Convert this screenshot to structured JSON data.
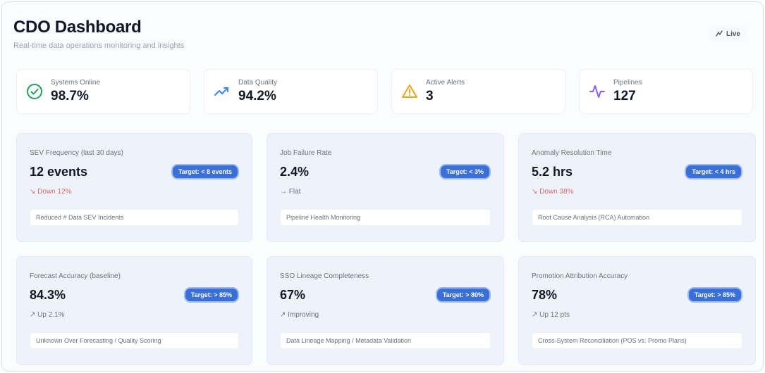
{
  "header": {
    "title": "CDO Dashboard",
    "subtitle": "Real-time data operations monitoring and insights",
    "live_label": "Live"
  },
  "kpis": [
    {
      "label": "Systems Online",
      "value": "98.7%",
      "icon": "check-circle-icon",
      "color": "#22a05a"
    },
    {
      "label": "Data Quality",
      "value": "94.2%",
      "icon": "trending-up-icon",
      "color": "#3b82f6"
    },
    {
      "label": "Active Alerts",
      "value": "3",
      "icon": "warning-triangle-icon",
      "color": "#e6a817"
    },
    {
      "label": "Pipelines",
      "value": "127",
      "icon": "activity-icon",
      "color": "#8b5cf6"
    }
  ],
  "cards": [
    {
      "label": "SEV Frequency (last 30 days)",
      "value": "12 events",
      "target": "Target: < 8 events",
      "trend": "↘ Down 12%",
      "trend_type": "down",
      "note": "Reduced # Data SEV Incidents"
    },
    {
      "label": "Job Failure Rate",
      "value": "2.4%",
      "target": "Target: < 3%",
      "trend": "→ Flat",
      "trend_type": "flat",
      "note": "Pipeline Health Monitoring"
    },
    {
      "label": "Anomaly Resolution Time",
      "value": "5.2 hrs",
      "target": "Target: < 4 hrs",
      "trend": "↘ Down 38%",
      "trend_type": "down",
      "note": "Root Cause Analysis (RCA) Automation"
    },
    {
      "label": "Forecast Accuracy (baseline)",
      "value": "84.3%",
      "target": "Target: > 85%",
      "trend": "↗ Up 2.1%",
      "trend_type": "up",
      "note": "Unknown Over Forecasting / Quality Scoring"
    },
    {
      "label": "SSO Lineage Completeness",
      "value": "67%",
      "target": "Target: > 80%",
      "trend": "↗ Improving",
      "trend_type": "up",
      "note": "Data Lineage Mapping / Metadata Validation"
    },
    {
      "label": "Promotion Attribution Accuracy",
      "value": "78%",
      "target": "Target: > 85%",
      "trend": "↗ Up 12 pts",
      "trend_type": "up",
      "note": "Cross-System Reconciliation (POS vs. Promo Plans)"
    }
  ]
}
